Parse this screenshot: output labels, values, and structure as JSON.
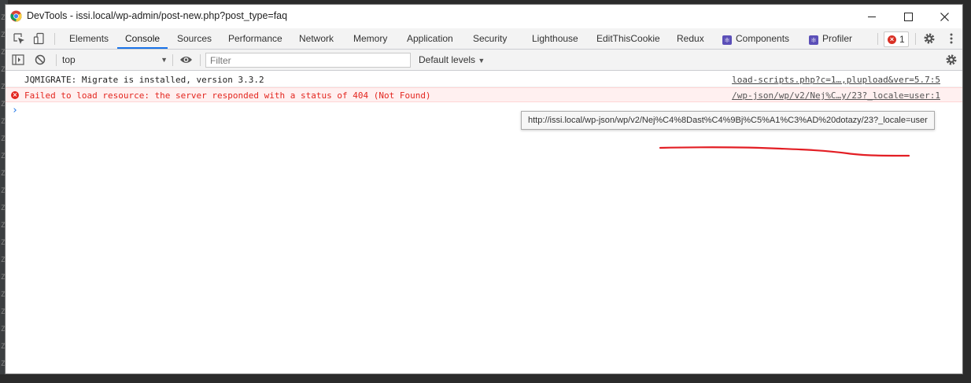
{
  "window": {
    "title": "DevTools - issi.local/wp-admin/post-new.php?post_type=faq"
  },
  "tabs": [
    {
      "label": "Elements"
    },
    {
      "label": "Console",
      "active": true
    },
    {
      "label": "Sources"
    },
    {
      "label": "Performance"
    },
    {
      "label": "Network"
    },
    {
      "label": "Memory"
    },
    {
      "label": "Application"
    },
    {
      "label": "Security"
    },
    {
      "label": "Lighthouse"
    },
    {
      "label": "EditThisCookie"
    },
    {
      "label": "Redux"
    },
    {
      "label": "Components",
      "icon": "react-icon"
    },
    {
      "label": "Profiler",
      "icon": "react-icon"
    }
  ],
  "error_badge": {
    "count": "1"
  },
  "toolbar": {
    "context": "top",
    "filter_placeholder": "Filter",
    "levels": "Default levels"
  },
  "console": {
    "messages": [
      {
        "level": "log",
        "text": "JQMIGRATE: Migrate is installed, version 3.3.2",
        "source": "load-scripts.php?c=1…,plupload&ver=5.7:5"
      },
      {
        "level": "error",
        "text": "Failed to load resource: the server responded with a status of 404 (Not Found)",
        "source": "/wp-json/wp/v2/Nej%C…y/23?_locale=user:1"
      }
    ],
    "tooltip": "http://issi.local/wp-json/wp/v2/Nej%C4%8Dast%C4%9Bj%C5%A1%C3%AD%20dotazy/23?_locale=user"
  },
  "colors": {
    "accent": "#1a73e8",
    "error": "#e3261f",
    "annotation": "#e31e24"
  }
}
